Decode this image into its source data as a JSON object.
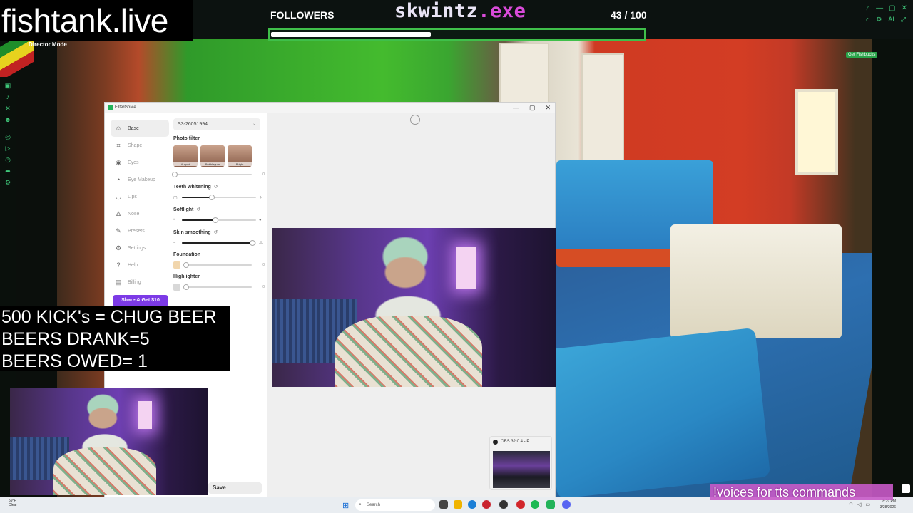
{
  "brand": "fishtank.live",
  "overlay": {
    "followers_label": "FOLLOWERS",
    "streamer_name_main": "skwintz",
    "streamer_name_ext": ".exe",
    "followers_count": "43 / 100",
    "followers_progress": 0.43,
    "director_mode": "Director Mode",
    "get_fishbucks": "Get Fishbucks",
    "ai_label": "AI"
  },
  "beer_overlay": {
    "line1": "500 KICK's = CHUG BEER",
    "line2": "BEERS DRANK=5",
    "line3": "BEERS OWED= 1"
  },
  "app": {
    "title": "FilterGoMe",
    "nav": [
      {
        "label": "Base",
        "icon": "face-icon",
        "active": true
      },
      {
        "label": "Shape",
        "icon": "shape-icon",
        "active": false
      },
      {
        "label": "Eyes",
        "icon": "eye-icon",
        "active": false
      },
      {
        "label": "Eye Makeup",
        "icon": "eye-makeup-icon",
        "active": false
      },
      {
        "label": "Lips",
        "icon": "lips-icon",
        "active": false
      },
      {
        "label": "Nose",
        "icon": "nose-icon",
        "active": false
      },
      {
        "label": "Presets",
        "icon": "brush-icon",
        "active": false
      },
      {
        "label": "Settings",
        "icon": "gear-icon",
        "active": false
      },
      {
        "label": "Help",
        "icon": "help-icon",
        "active": false
      },
      {
        "label": "Billing",
        "icon": "billing-icon",
        "active": false
      }
    ],
    "share_button": "Share & Get $10",
    "preset_value": "S3-26051994",
    "photo_filter_title": "Photo filter",
    "filters": [
      "August",
      "Bubblegum",
      "Bright"
    ],
    "filter_value": "0",
    "teeth_title": "Teeth whitening",
    "teeth_level": 0.4,
    "softlight_title": "Softlight",
    "softlight_level": 0.45,
    "skin_title": "Skin smoothing",
    "skin_level": 0.95,
    "foundation_title": "Foundation",
    "foundation_value": "0",
    "highlighter_title": "Highlighter",
    "highlighter_value": "0",
    "save_button": "Save",
    "colors": {
      "accent": "#7c3ae6",
      "brand_green": "#22b35a"
    }
  },
  "obs_popup": {
    "title": "OBS 32.0.4 - P..."
  },
  "taskbar": {
    "weather_temp": "59°F",
    "weather_desc": "Clear",
    "search_placeholder": "Search",
    "time": "8:29 PM",
    "date": "3/28/2026"
  },
  "tts_banner": "!voices for tts commands"
}
